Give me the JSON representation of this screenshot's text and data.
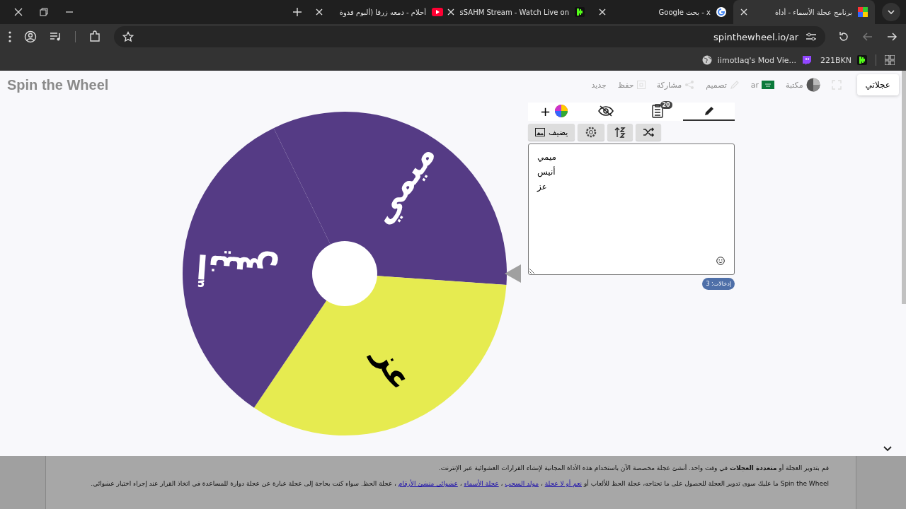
{
  "browser": {
    "tabs": [
      {
        "title": "برنامج عجلة الأسماء - أداة",
        "selected": true,
        "kind": "colorwheel"
      },
      {
        "title": "x - بحث Google",
        "selected": false,
        "kind": "google"
      },
      {
        "title": "sSAHM Stream - Watch Live on",
        "selected": false,
        "kind": "kick"
      },
      {
        "title": "أحلام - دمعه زرقا (ألبوم فدوة",
        "selected": false,
        "kind": "youtube"
      }
    ],
    "url": "spinthewheel.io/ar",
    "bookmarks": [
      {
        "label": "221BKN",
        "kind": "kick"
      },
      {
        "label": "iimotlaq's Mod Vie...",
        "kind": "twitch"
      }
    ]
  },
  "header": {
    "logo": "Spin the Wheel",
    "items": [
      {
        "kind": "my-wheels",
        "label": "عجلاتي"
      },
      {
        "kind": "fullscreen"
      },
      {
        "kind": "library",
        "label": "مكتبة"
      },
      {
        "kind": "language",
        "label": "ar"
      },
      {
        "kind": "design",
        "label": "تصميم"
      },
      {
        "kind": "share",
        "label": "مشاركة"
      },
      {
        "kind": "save",
        "label": "حفظ"
      },
      {
        "kind": "new",
        "label": "جديد"
      }
    ]
  },
  "wheel": {
    "slices": [
      {
        "label": "ميمي",
        "color": "#553b85"
      },
      {
        "label": "عز",
        "color": "#e6eb50"
      },
      {
        "label": "أنيس",
        "color": "#553b85"
      }
    ]
  },
  "editor": {
    "tabs": [
      {
        "kind": "edit",
        "selected": true
      },
      {
        "kind": "results",
        "selected": false,
        "badge": "20"
      },
      {
        "kind": "hide",
        "selected": false
      },
      {
        "kind": "add",
        "selected": false,
        "label": "+"
      }
    ],
    "tools": [
      {
        "kind": "shuffle"
      },
      {
        "kind": "sort"
      },
      {
        "kind": "settings"
      },
      {
        "kind": "image",
        "label": "يضيف"
      }
    ],
    "entries": [
      "ميمي",
      "أنيس",
      "عز"
    ],
    "count": "إدخالات: 3"
  },
  "description": {
    "lines": [
      [
        {
          "text": "قم بتدوير العجلة أو **متعددة العجلات** في وقت واحد. أنشئ عجلة مخصصة الآن باستخدام هذه الأداة المجانية لإنشاء القرارات العشوائية عبر الإنترنت.",
          "link": false
        }
      ],
      [
        {
          "text": "Spin the Wheel ما عليك سوى تدوير العجلة للحصول على ما تحتاجه، عجلة الحظ للألعاب أو",
          "link": false
        },
        {
          "text": "نعم أو لا عجلة",
          "link": true
        },
        {
          "text": "،",
          "link": false
        },
        {
          "text": "مولد السحب",
          "link": true
        },
        {
          "text": "،",
          "link": false
        },
        {
          "text": "عجلة الأسماء",
          "link": true
        },
        {
          "text": "،",
          "link": false
        },
        {
          "text": "عشوائي منشئ الأرقام",
          "link": true
        },
        {
          "text": "، عجلة الحظ. سواء كنت بحاجة إلى عجلة عبارة عن عجلة دوارة للمساعدة في اتخاذ القرار عند إجراء اختيار عشوائي.",
          "link": false
        }
      ]
    ]
  }
}
